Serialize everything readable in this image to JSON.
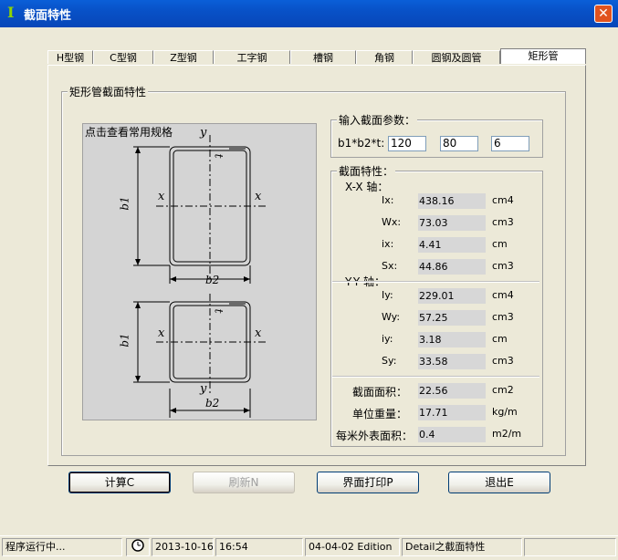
{
  "window": {
    "title": "截面特性",
    "close_glyph": "✕"
  },
  "tabs": [
    {
      "label": "H型钢"
    },
    {
      "label": "C型钢"
    },
    {
      "label": "Z型钢"
    },
    {
      "label": "工字钢"
    },
    {
      "label": "槽钢"
    },
    {
      "label": "角钢"
    },
    {
      "label": "圆钢及圆管"
    },
    {
      "label": "矩形管",
      "active": true
    }
  ],
  "panel_title": "矩形管截面特性",
  "diagram": {
    "caption": "点击查看常用规格",
    "labels": {
      "y": "y",
      "x": "x",
      "t": "t",
      "b1": "b1",
      "b2": "b2"
    }
  },
  "input_group": {
    "title": "输入截面参数：",
    "field_label": "b1*b2*t:",
    "b1": "120",
    "b2": "80",
    "t": "6"
  },
  "props_group": {
    "title": "截面特性：",
    "xx_title": "X-X 轴：",
    "yy_title": "Y-Y 轴：",
    "xx": [
      {
        "label": "Ix:",
        "value": "438.16",
        "unit": "cm4"
      },
      {
        "label": "Wx:",
        "value": "73.03",
        "unit": "cm3"
      },
      {
        "label": "ix:",
        "value": "4.41",
        "unit": "cm"
      },
      {
        "label": "Sx:",
        "value": "44.86",
        "unit": "cm3"
      }
    ],
    "yy": [
      {
        "label": "Iy:",
        "value": "229.01",
        "unit": "cm4"
      },
      {
        "label": "Wy:",
        "value": "57.25",
        "unit": "cm3"
      },
      {
        "label": "iy:",
        "value": "3.18",
        "unit": "cm"
      },
      {
        "label": "Sy:",
        "value": "33.58",
        "unit": "cm3"
      }
    ],
    "area": {
      "label": "截面面积：",
      "value": "22.56",
      "unit": "cm2"
    },
    "weight": {
      "label": "单位重量：",
      "value": "17.71",
      "unit": "kg/m"
    },
    "surface": {
      "label": "每米外表面积：",
      "value": "0.4",
      "unit": "m2/m"
    }
  },
  "buttons": {
    "calc": "计算C",
    "refresh": "刷新N",
    "print": "界面打印P",
    "exit": "退出E"
  },
  "status": {
    "running": "程序运行中...",
    "date": "2013-10-16",
    "time": "16:54",
    "edition": "04-04-02 Edition",
    "detail": "Detail之截面特性"
  }
}
